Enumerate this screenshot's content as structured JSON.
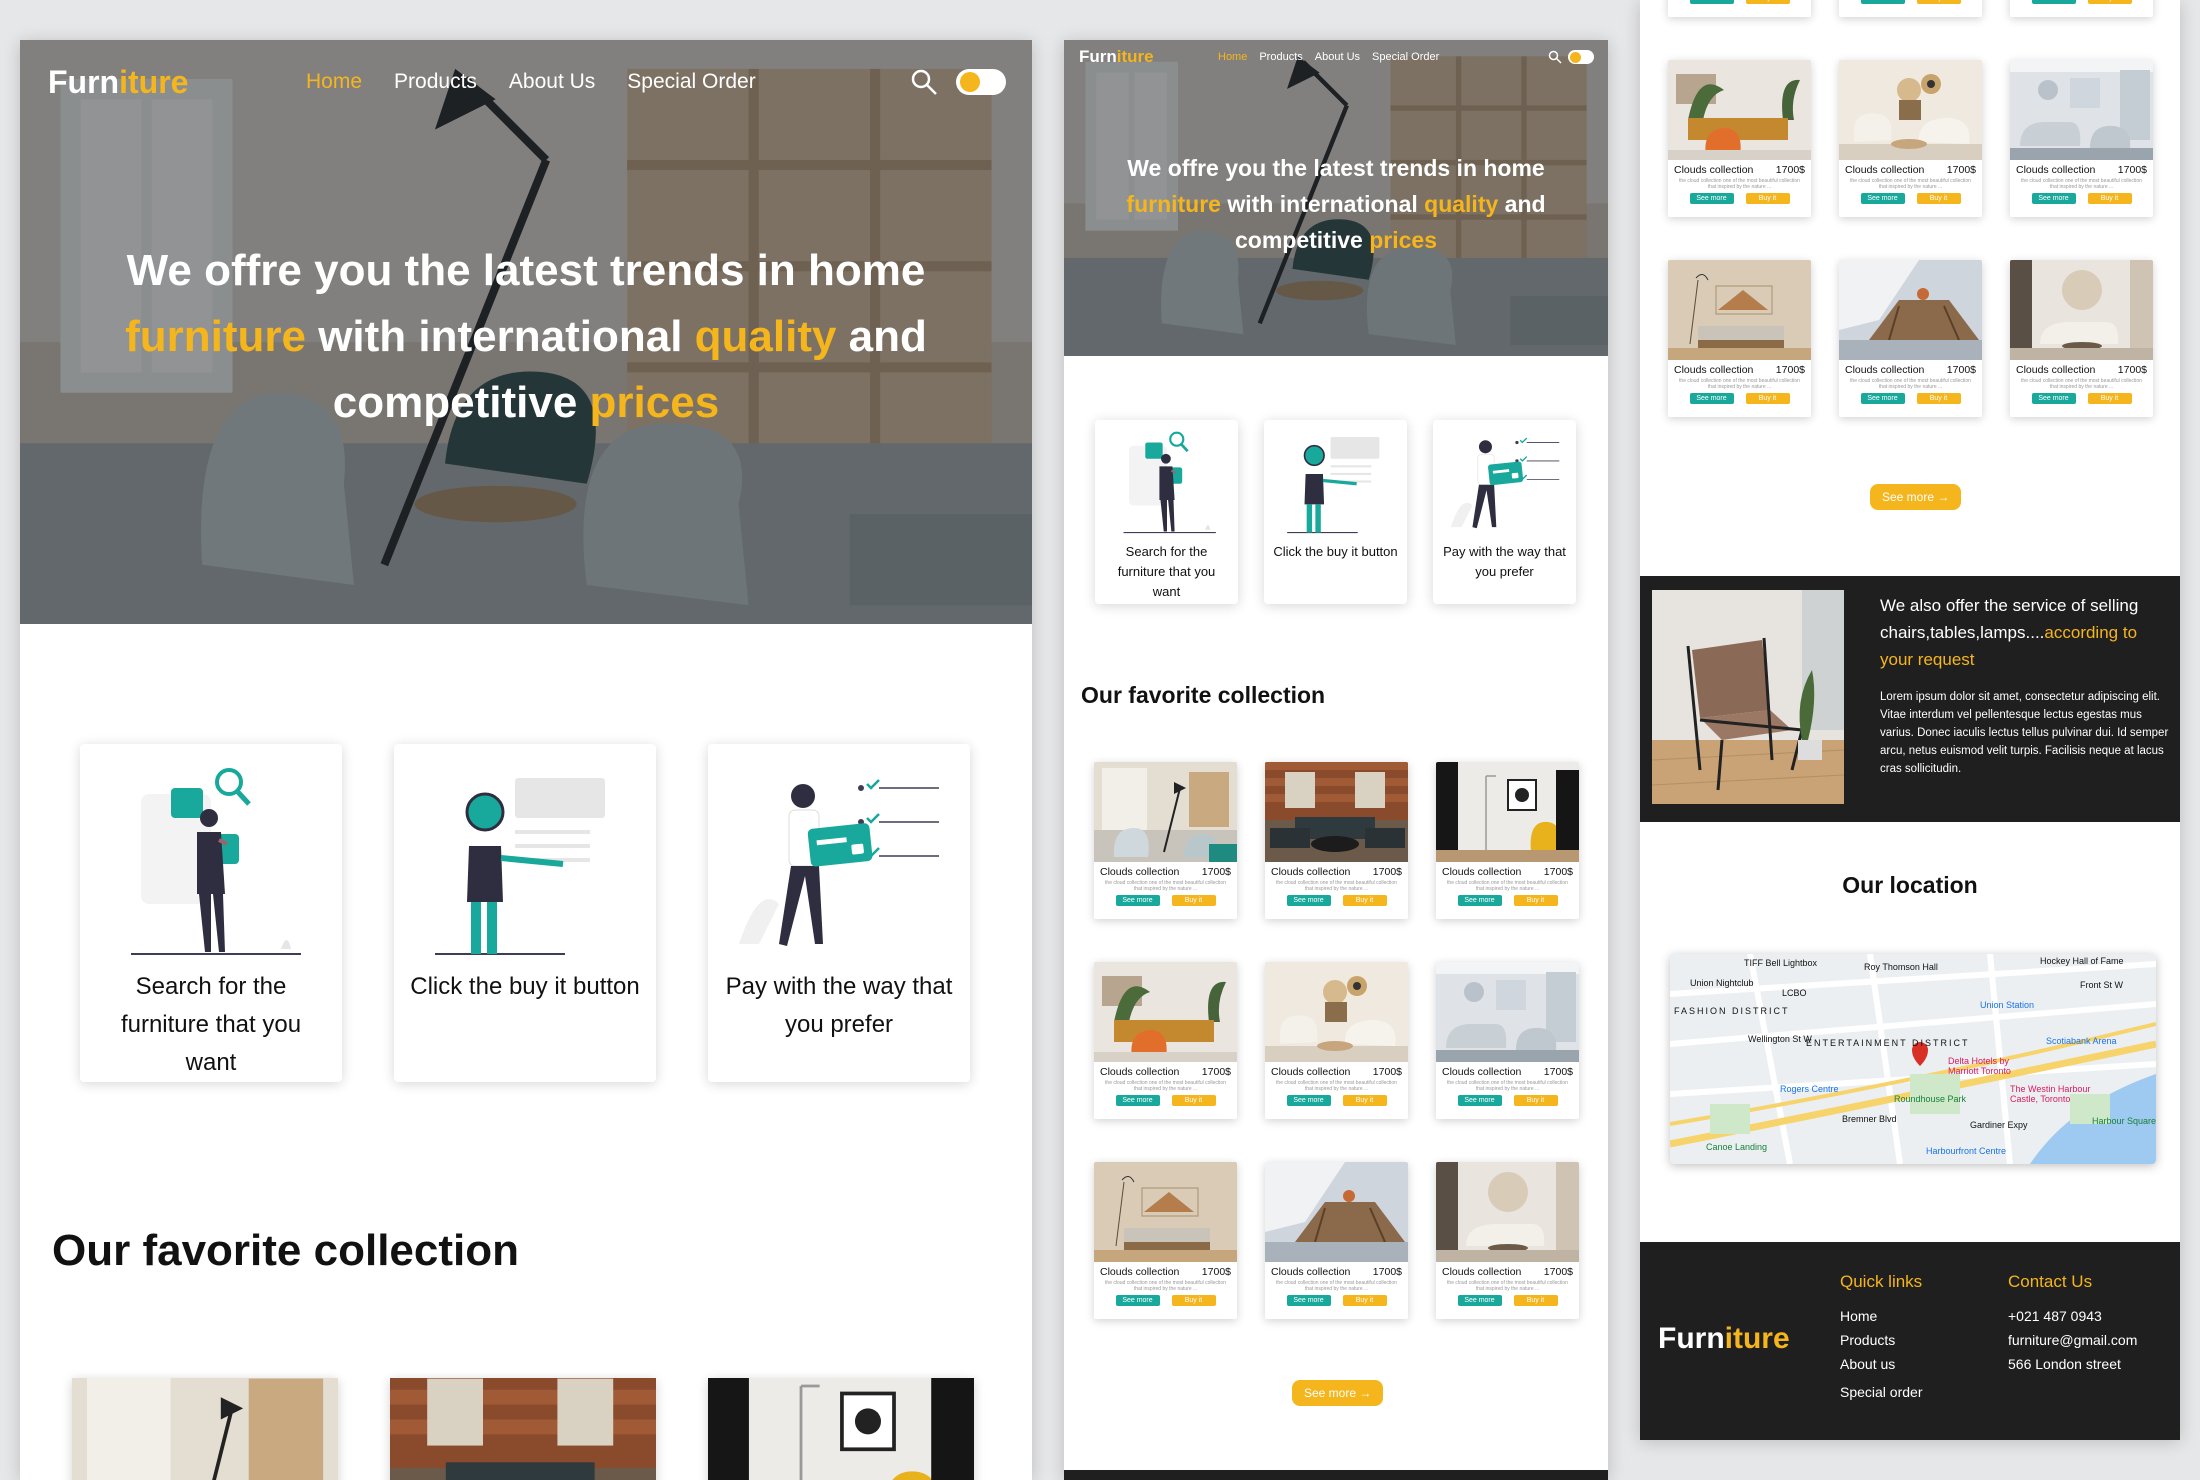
{
  "brand": {
    "name_part1": "Furn",
    "name_part2": "iture"
  },
  "nav": {
    "home": "Home",
    "products": "Products",
    "about": "About Us",
    "special": "Special Order"
  },
  "hero": {
    "line1": "We offre you the latest trends in home",
    "line2_hl1": "furniture",
    "line2_mid": " with international ",
    "line2_hl2": "quality",
    "line2_end": " and",
    "line3_start": "competitive ",
    "line3_hl": "prices"
  },
  "steps": [
    {
      "label": "Search for the furniture that you want"
    },
    {
      "label": "Click the buy it button"
    },
    {
      "label": "Pay with the way that you prefer"
    }
  ],
  "collection": {
    "title": "Our favorite collection",
    "see_more": "See more →"
  },
  "product": {
    "name": "Clouds collection",
    "price": "1700$",
    "desc": "the cloud collection one of the most beautiful collection that inspired by the nature ...",
    "btn_see": "See more",
    "btn_buy": "Buy it"
  },
  "service": {
    "head_start": "We also offer the service of selling chairs,tables,lamps....",
    "head_hl": "according to your request",
    "body": "Lorem ipsum dolor sit amet, consectetur adipiscing elit. Vitae interdum vel pellentesque lectus egestas mus varius. Donec iaculis lectus tellus pulvinar dui. Id semper arcu, netus euismod velit turpis. Facilisis neque at lacus cras sollicitudin."
  },
  "location": {
    "title": "Our location",
    "labels": [
      "TIFF Bell Lightbox",
      "Roy Thomson Hall",
      "Hockey Hall of Fame",
      "Union Nightclub",
      "LCBO",
      "FASHION DISTRICT",
      "ENTERTAINMENT DISTRICT",
      "Union Station",
      "Scotiabank Arena",
      "Rogers Centre",
      "Delta Hotels by Marriott Toronto",
      "Roundhouse Park",
      "The Westin Harbour Castle, Toronto",
      "Harbour Square Park",
      "Canoe Landing",
      "Harbourfront Centre",
      "Bremner Blvd",
      "Gardiner Expy",
      "Front St W",
      "Wellington St W"
    ]
  },
  "footer": {
    "quick_title": "Quick links",
    "quick": [
      "Home",
      "Products",
      "About us",
      "Special order"
    ],
    "contact_title": "Contact Us",
    "contact": [
      "+021 487 0943",
      "furniture@gmail.com",
      "566 London street"
    ]
  },
  "colors": {
    "accent": "#f5b51d",
    "teal": "#18a89c",
    "dark": "#1f1f1f"
  }
}
